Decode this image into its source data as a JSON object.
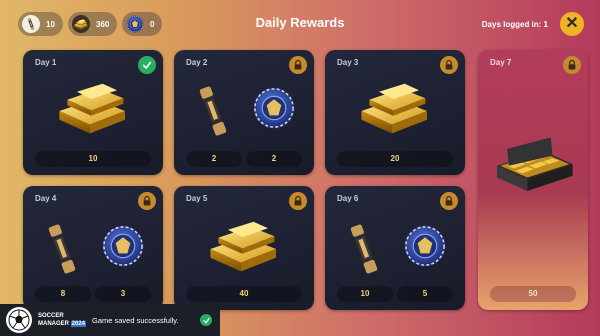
{
  "header": {
    "title": "Daily Rewards",
    "logged_in": "Days logged in: 1",
    "resources": [
      {
        "icon": "energy-drink-icon",
        "value": "10"
      },
      {
        "icon": "gold-bars-icon",
        "value": "360"
      },
      {
        "icon": "coin-icon",
        "value": "0"
      }
    ],
    "close_icon": "close-icon"
  },
  "days": [
    {
      "label": "Day 1",
      "status": "claimed",
      "rewards": [
        {
          "icon": "gold-bars-icon",
          "amount": "10"
        }
      ]
    },
    {
      "label": "Day 2",
      "status": "locked",
      "rewards": [
        {
          "icon": "energy-drink-icon",
          "amount": "2"
        },
        {
          "icon": "coin-icon",
          "amount": "2"
        }
      ]
    },
    {
      "label": "Day 3",
      "status": "locked",
      "rewards": [
        {
          "icon": "gold-bars-icon",
          "amount": "20"
        }
      ]
    },
    {
      "label": "Day 4",
      "status": "locked",
      "rewards": [
        {
          "icon": "energy-drink-icon",
          "amount": "8"
        },
        {
          "icon": "coin-icon",
          "amount": "3"
        }
      ]
    },
    {
      "label": "Day 5",
      "status": "locked",
      "rewards": [
        {
          "icon": "gold-bars-icon",
          "amount": "40"
        }
      ]
    },
    {
      "label": "Day 6",
      "status": "locked",
      "rewards": [
        {
          "icon": "energy-drink-icon",
          "amount": "10"
        },
        {
          "icon": "coin-icon",
          "amount": "5"
        }
      ]
    },
    {
      "label": "Day 7",
      "status": "locked",
      "rewards": [
        {
          "icon": "briefcase-gold-icon",
          "amount": "50"
        }
      ]
    }
  ],
  "toast": {
    "brand_line1": "SOCCER",
    "brand_line2": "MANAGER",
    "brand_year": "2024",
    "message": "Game saved successfully."
  },
  "colors": {
    "accent": "#f0b323",
    "lock_badge": "#c68a2e",
    "check_badge": "#27ae60",
    "amount_text": "#f2d37a"
  }
}
